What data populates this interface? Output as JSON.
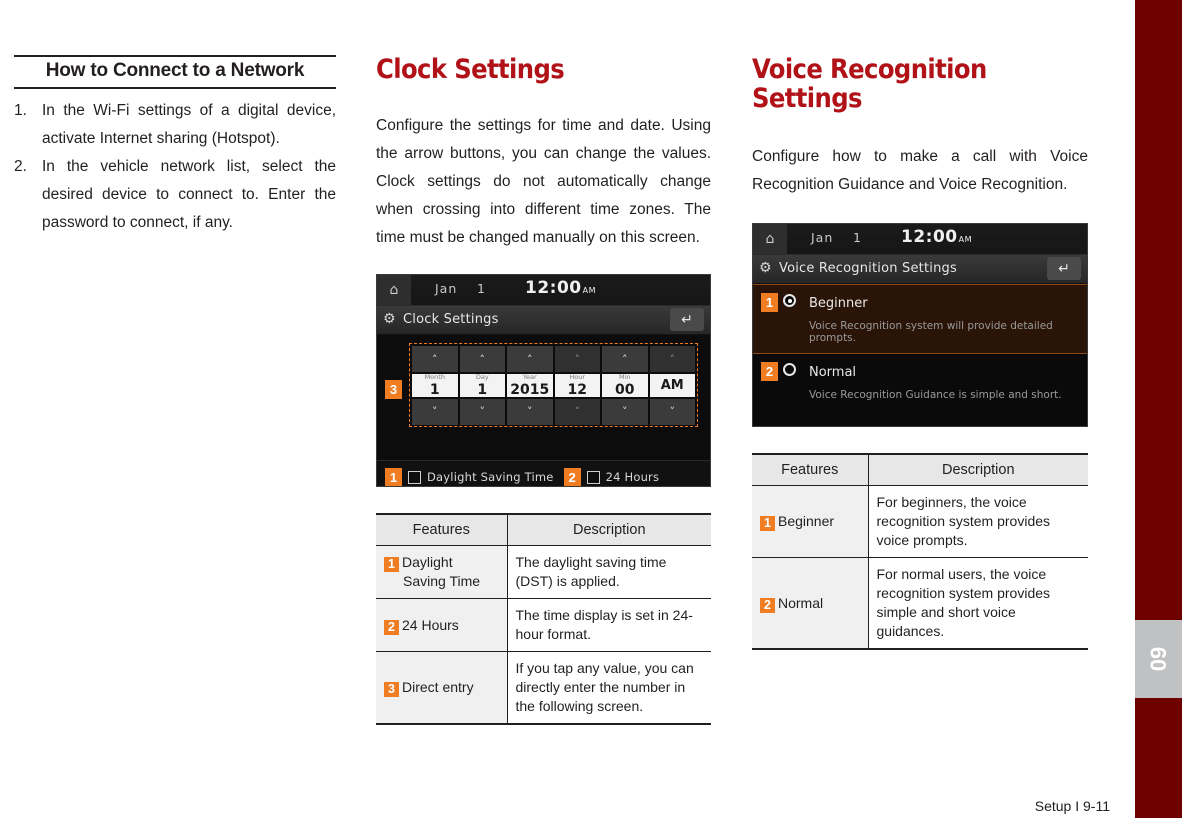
{
  "sidebar": {
    "tab_number": "09",
    "color": "#6e0000",
    "tab_color": "#bfc1c3"
  },
  "footer": {
    "text": "Setup I 9-11"
  },
  "accent": {
    "orange": "#f07d22",
    "heading_red": "#b01217"
  },
  "left_column": {
    "heading": "How to Connect to a Network",
    "steps": [
      {
        "num": "1.",
        "text": "In the Wi-Fi settings of a digital device, activate Internet sharing (Hotspot)."
      },
      {
        "num": "2.",
        "text": "In the vehicle network list, select the desired device to connect to. Enter the password to connect, if any."
      }
    ]
  },
  "middle_column": {
    "heading": "Clock Settings",
    "intro": "Configure the settings for time and date. Using the arrow buttons, you can change the values. Clock settings do not automatically change when crossing into different time zones. The time must be changed manually on this screen.",
    "device": {
      "home_icon": "home-icon",
      "status_date": "Jan",
      "status_day": "1",
      "status_time": "12:00",
      "status_ampm": "AM",
      "gear_icon": "gear-icon",
      "title": "Clock Settings",
      "back_icon": "back-arrow-icon",
      "up_arrow": "˄",
      "down_arrow": "˅",
      "spinners": [
        {
          "label": "Month",
          "value": "1"
        },
        {
          "label": "Day",
          "value": "1"
        },
        {
          "label": "Year",
          "value": "2015"
        },
        {
          "label": "Hour",
          "value": "12"
        },
        {
          "label": "Min",
          "value": "00"
        },
        {
          "label": "",
          "value": "AM"
        }
      ],
      "checkboxes": [
        {
          "badge": "1",
          "label": "Daylight Saving Time",
          "checked": false
        },
        {
          "badge": "2",
          "label": "24 Hours",
          "checked": false
        }
      ],
      "callout_direct_entry": "3"
    },
    "table": {
      "headers": [
        "Features",
        "Description"
      ],
      "rows": [
        {
          "badge": "1",
          "feature": "Daylight",
          "feature_line2": "Saving Time",
          "description": "The daylight saving time (DST) is applied."
        },
        {
          "badge": "2",
          "feature": "24 Hours",
          "feature_line2": "",
          "description": "The time display is set in 24-hour format."
        },
        {
          "badge": "3",
          "feature": "Direct entry",
          "feature_line2": "",
          "description": "If you tap any value, you can directly enter the number in the following screen."
        }
      ]
    }
  },
  "right_column": {
    "heading_line1": "Voice Recognition",
    "heading_line2": "Settings",
    "intro": "Configure how to make a call with Voice Recognition Guidance and Voice Recognition.",
    "device": {
      "home_icon": "home-icon",
      "status_date": "Jan",
      "status_day": "1",
      "status_time": "12:00",
      "status_ampm": "AM",
      "gear_icon": "gear-icon",
      "title": "Voice Recognition Settings",
      "back_icon": "back-arrow-icon",
      "options": [
        {
          "badge": "1",
          "label": "Beginner",
          "description": "Voice Recognition system will provide detailed prompts.",
          "selected": true
        },
        {
          "badge": "2",
          "label": "Normal",
          "description": "Voice Recognition Guidance is simple and short.",
          "selected": false
        }
      ]
    },
    "table": {
      "headers": [
        "Features",
        "Description"
      ],
      "rows": [
        {
          "badge": "1",
          "feature": "Beginner",
          "description": "For beginners, the voice recognition system provides voice prompts."
        },
        {
          "badge": "2",
          "feature": "Normal",
          "description": "For normal users, the voice recognition system provides simple and short voice guidances."
        }
      ]
    }
  }
}
